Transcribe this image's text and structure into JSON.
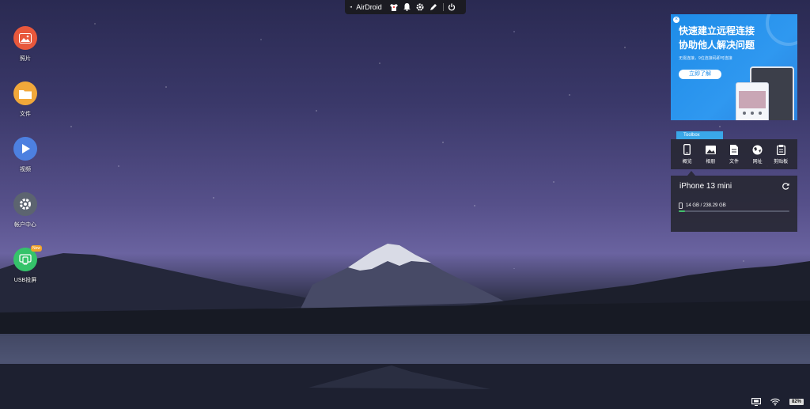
{
  "topbar": {
    "brand": "AirDroid",
    "icons": [
      "airdroid-logo-icon",
      "shirt-icon",
      "bell-icon",
      "gear-icon",
      "pen-icon",
      "power-icon"
    ]
  },
  "desktop_apps": [
    {
      "label": "照片",
      "icon": "photo-icon",
      "color": "#e8583c"
    },
    {
      "label": "文件",
      "icon": "folder-icon",
      "color": "#f1a83a"
    },
    {
      "label": "视频",
      "icon": "video-icon",
      "color": "#4d80e0"
    },
    {
      "label": "帐户中心",
      "icon": "gear-icon",
      "color": "#5c6470"
    },
    {
      "label": "USB投屏",
      "icon": "usb-mirror-icon",
      "color": "#35c36a",
      "badge": "New"
    }
  ],
  "ad": {
    "title_line1": "快速建立远程连接",
    "title_line2": "协助他人解决问题",
    "subtitle": "无需连接，9位连接码即可连接",
    "cta": "立即了解"
  },
  "toolbox": {
    "tab_label": "Toolbox",
    "items": [
      {
        "label": "概览",
        "icon": "phone-icon"
      },
      {
        "label": "相册",
        "icon": "image-icon"
      },
      {
        "label": "文件",
        "icon": "document-icon"
      },
      {
        "label": "网址",
        "icon": "globe-icon"
      },
      {
        "label": "剪贴板",
        "icon": "clipboard-icon"
      }
    ]
  },
  "device": {
    "name": "iPhone 13 mini",
    "storage": "14 GB / 238.29 GB",
    "storage_fraction": 0.06
  },
  "tray": {
    "battery": "82%",
    "icons": [
      "monitor-icon",
      "wifi-icon"
    ]
  }
}
